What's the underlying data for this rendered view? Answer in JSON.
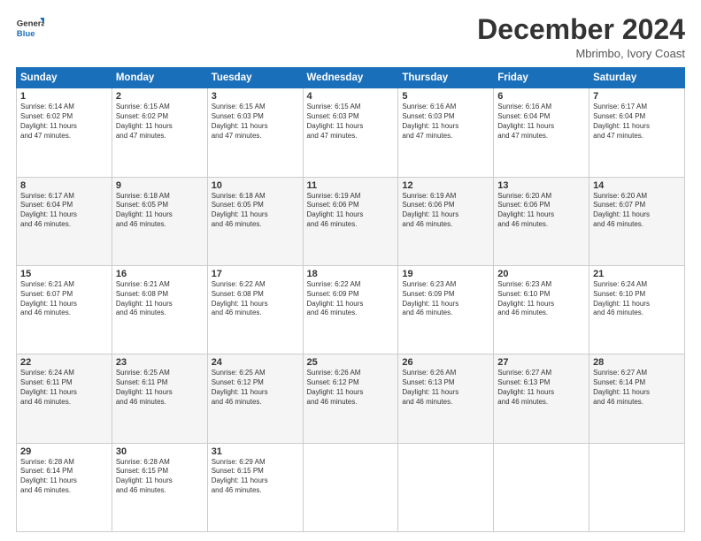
{
  "logo": {
    "line1": "General",
    "line2": "Blue"
  },
  "title": "December 2024",
  "location": "Mbrimbo, Ivory Coast",
  "days_header": [
    "Sunday",
    "Monday",
    "Tuesday",
    "Wednesday",
    "Thursday",
    "Friday",
    "Saturday"
  ],
  "weeks": [
    [
      {
        "day": "1",
        "info": "Sunrise: 6:14 AM\nSunset: 6:02 PM\nDaylight: 11 hours\nand 47 minutes."
      },
      {
        "day": "2",
        "info": "Sunrise: 6:15 AM\nSunset: 6:02 PM\nDaylight: 11 hours\nand 47 minutes."
      },
      {
        "day": "3",
        "info": "Sunrise: 6:15 AM\nSunset: 6:03 PM\nDaylight: 11 hours\nand 47 minutes."
      },
      {
        "day": "4",
        "info": "Sunrise: 6:15 AM\nSunset: 6:03 PM\nDaylight: 11 hours\nand 47 minutes."
      },
      {
        "day": "5",
        "info": "Sunrise: 6:16 AM\nSunset: 6:03 PM\nDaylight: 11 hours\nand 47 minutes."
      },
      {
        "day": "6",
        "info": "Sunrise: 6:16 AM\nSunset: 6:04 PM\nDaylight: 11 hours\nand 47 minutes."
      },
      {
        "day": "7",
        "info": "Sunrise: 6:17 AM\nSunset: 6:04 PM\nDaylight: 11 hours\nand 47 minutes."
      }
    ],
    [
      {
        "day": "8",
        "info": "Sunrise: 6:17 AM\nSunset: 6:04 PM\nDaylight: 11 hours\nand 46 minutes."
      },
      {
        "day": "9",
        "info": "Sunrise: 6:18 AM\nSunset: 6:05 PM\nDaylight: 11 hours\nand 46 minutes."
      },
      {
        "day": "10",
        "info": "Sunrise: 6:18 AM\nSunset: 6:05 PM\nDaylight: 11 hours\nand 46 minutes."
      },
      {
        "day": "11",
        "info": "Sunrise: 6:19 AM\nSunset: 6:06 PM\nDaylight: 11 hours\nand 46 minutes."
      },
      {
        "day": "12",
        "info": "Sunrise: 6:19 AM\nSunset: 6:06 PM\nDaylight: 11 hours\nand 46 minutes."
      },
      {
        "day": "13",
        "info": "Sunrise: 6:20 AM\nSunset: 6:06 PM\nDaylight: 11 hours\nand 46 minutes."
      },
      {
        "day": "14",
        "info": "Sunrise: 6:20 AM\nSunset: 6:07 PM\nDaylight: 11 hours\nand 46 minutes."
      }
    ],
    [
      {
        "day": "15",
        "info": "Sunrise: 6:21 AM\nSunset: 6:07 PM\nDaylight: 11 hours\nand 46 minutes."
      },
      {
        "day": "16",
        "info": "Sunrise: 6:21 AM\nSunset: 6:08 PM\nDaylight: 11 hours\nand 46 minutes."
      },
      {
        "day": "17",
        "info": "Sunrise: 6:22 AM\nSunset: 6:08 PM\nDaylight: 11 hours\nand 46 minutes."
      },
      {
        "day": "18",
        "info": "Sunrise: 6:22 AM\nSunset: 6:09 PM\nDaylight: 11 hours\nand 46 minutes."
      },
      {
        "day": "19",
        "info": "Sunrise: 6:23 AM\nSunset: 6:09 PM\nDaylight: 11 hours\nand 46 minutes."
      },
      {
        "day": "20",
        "info": "Sunrise: 6:23 AM\nSunset: 6:10 PM\nDaylight: 11 hours\nand 46 minutes."
      },
      {
        "day": "21",
        "info": "Sunrise: 6:24 AM\nSunset: 6:10 PM\nDaylight: 11 hours\nand 46 minutes."
      }
    ],
    [
      {
        "day": "22",
        "info": "Sunrise: 6:24 AM\nSunset: 6:11 PM\nDaylight: 11 hours\nand 46 minutes."
      },
      {
        "day": "23",
        "info": "Sunrise: 6:25 AM\nSunset: 6:11 PM\nDaylight: 11 hours\nand 46 minutes."
      },
      {
        "day": "24",
        "info": "Sunrise: 6:25 AM\nSunset: 6:12 PM\nDaylight: 11 hours\nand 46 minutes."
      },
      {
        "day": "25",
        "info": "Sunrise: 6:26 AM\nSunset: 6:12 PM\nDaylight: 11 hours\nand 46 minutes."
      },
      {
        "day": "26",
        "info": "Sunrise: 6:26 AM\nSunset: 6:13 PM\nDaylight: 11 hours\nand 46 minutes."
      },
      {
        "day": "27",
        "info": "Sunrise: 6:27 AM\nSunset: 6:13 PM\nDaylight: 11 hours\nand 46 minutes."
      },
      {
        "day": "28",
        "info": "Sunrise: 6:27 AM\nSunset: 6:14 PM\nDaylight: 11 hours\nand 46 minutes."
      }
    ],
    [
      {
        "day": "29",
        "info": "Sunrise: 6:28 AM\nSunset: 6:14 PM\nDaylight: 11 hours\nand 46 minutes."
      },
      {
        "day": "30",
        "info": "Sunrise: 6:28 AM\nSunset: 6:15 PM\nDaylight: 11 hours\nand 46 minutes."
      },
      {
        "day": "31",
        "info": "Sunrise: 6:29 AM\nSunset: 6:15 PM\nDaylight: 11 hours\nand 46 minutes."
      },
      null,
      null,
      null,
      null
    ]
  ]
}
